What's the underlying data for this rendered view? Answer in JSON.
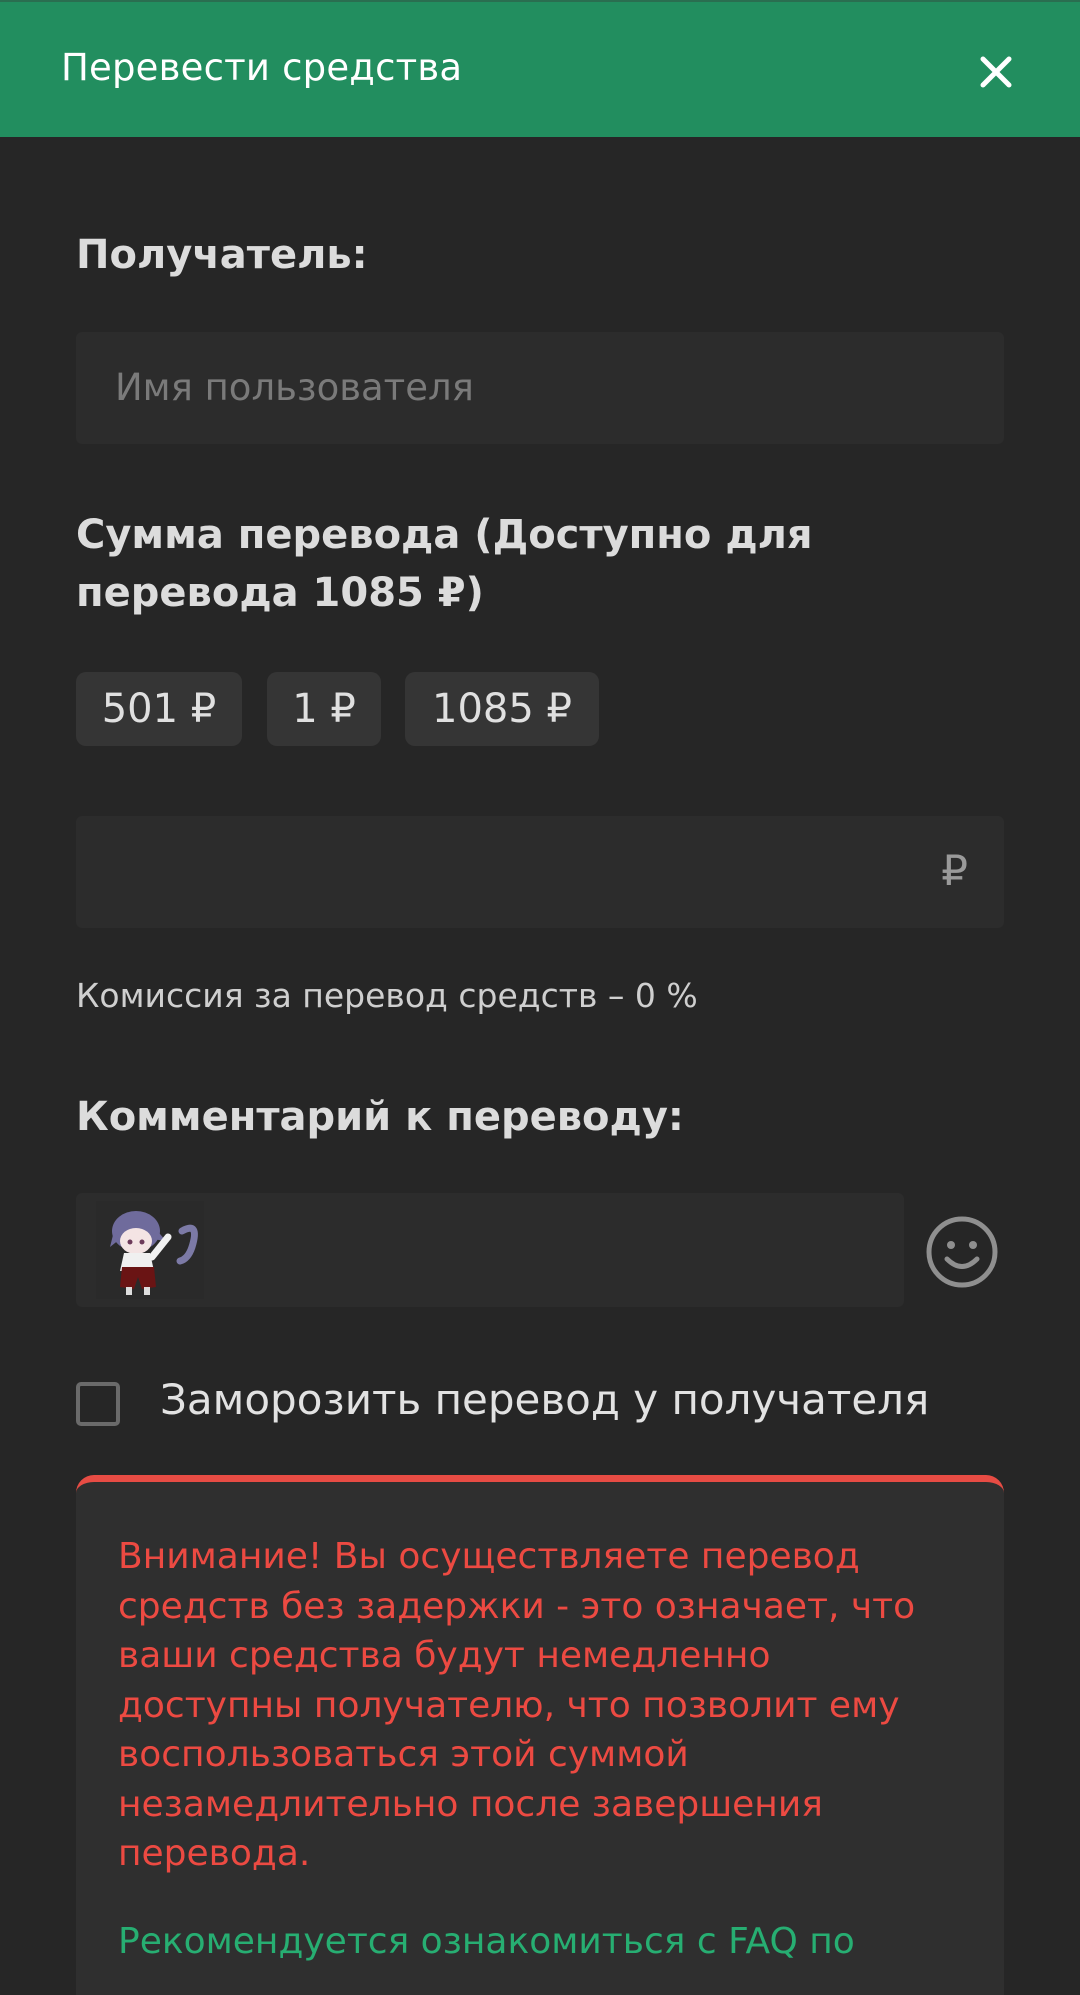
{
  "header": {
    "title": "Перевести средства",
    "close_icon": "close-icon"
  },
  "recipient": {
    "label": "Получатель:",
    "placeholder": "Имя пользователя"
  },
  "amount": {
    "label_line1": "Сумма перевода (Доступно для",
    "label_line2": "перевода 1085 ₽)",
    "chips": [
      "501 ₽",
      "1 ₽",
      "1085 ₽"
    ],
    "currency_sign": "₽"
  },
  "fee_text": "Комиссия за перевод средств – 0 %",
  "comment": {
    "label": "Комментарий к переводу:",
    "emoji_icon": "smiley-icon"
  },
  "freeze": {
    "label": "Заморозить перевод у получателя",
    "checked": false
  },
  "warning": {
    "lines": [
      "Внимание! Вы осуществляете перевод",
      "средств без задержки - это означает, что",
      "ваши средства будут немедленно",
      "доступны получателю, что позволит ему",
      "воспользоваться этой суммой",
      "незамедлительно после завершения",
      "перевода."
    ],
    "recommend": "Рекомендуется ознакомиться с FAQ по",
    "colors": {
      "warning": "#ec4a42",
      "recommend": "#27ae72",
      "accent": "#228e5f"
    }
  }
}
